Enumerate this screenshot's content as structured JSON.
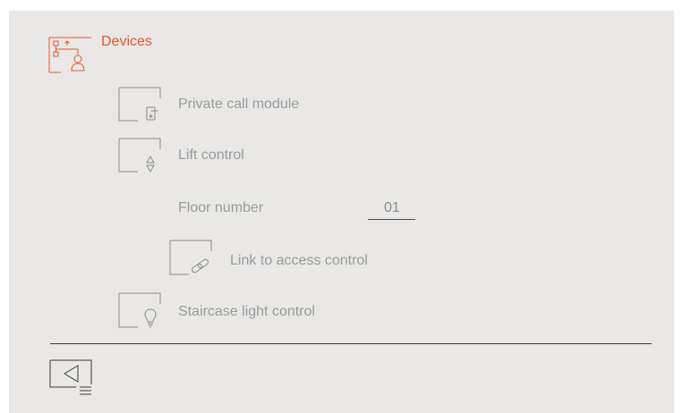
{
  "header": {
    "title": "Devices",
    "icon": "devices-icon",
    "accent_color": "#e4572e"
  },
  "settings": [
    {
      "label": "Private call module",
      "icon": "door-handle-icon"
    },
    {
      "label": "Lift control",
      "icon": "up-down-arrows-icon"
    },
    {
      "label": "Floor number",
      "value": "01"
    },
    {
      "label": "Link to access control",
      "icon": "chain-link-icon"
    },
    {
      "label": "Staircase light control",
      "icon": "light-bulb-icon"
    }
  ],
  "footer": {
    "back_icon": "back-menu-icon"
  }
}
